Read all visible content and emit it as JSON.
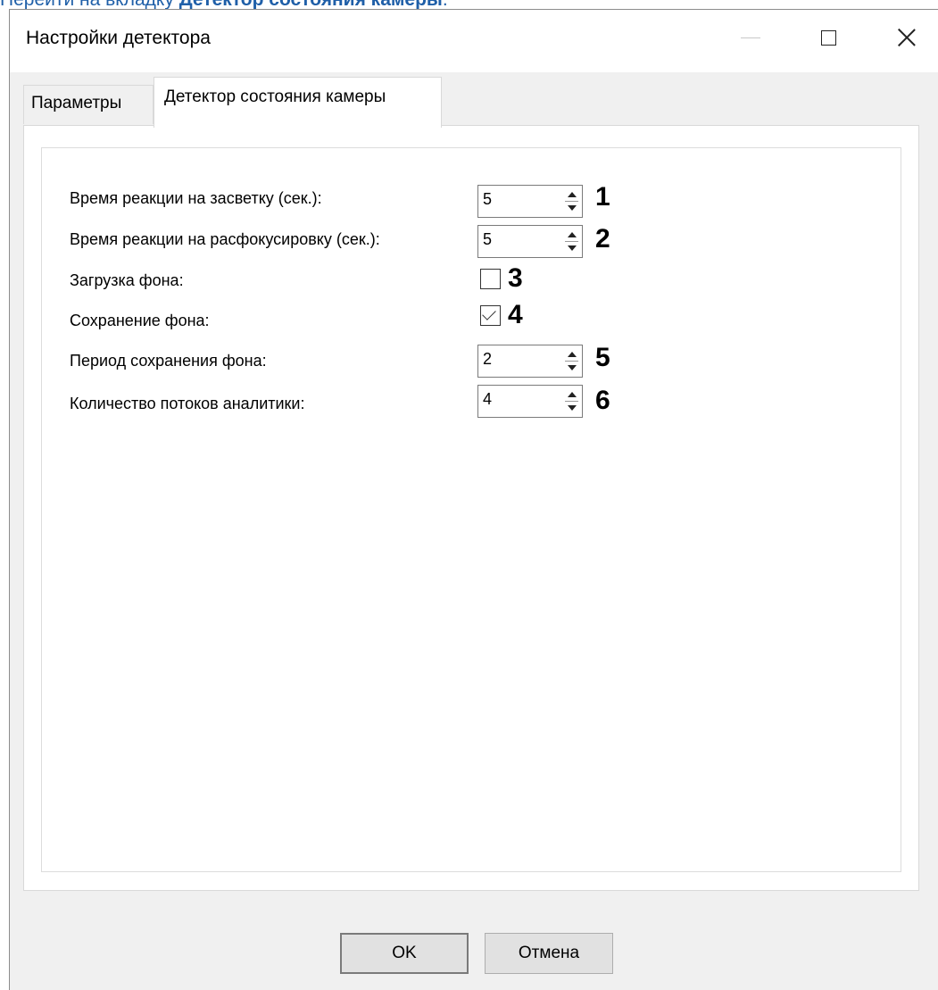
{
  "caption": {
    "prefix": "Перейти на вкладку ",
    "bold": "Детектор состояния камеры",
    "suffix": "."
  },
  "window": {
    "title": "Настройки детектора"
  },
  "tabs": [
    {
      "label": "Параметры",
      "active": false
    },
    {
      "label": "Детектор состояния камеры",
      "active": true
    }
  ],
  "fields": {
    "flare_time": {
      "label": "Время реакции на засветку (сек.):",
      "value": "5",
      "marker": "1"
    },
    "defocus_time": {
      "label": "Время реакции на расфокусировку (сек.):",
      "value": "5",
      "marker": "2"
    },
    "load_background": {
      "label": "Загрузка фона:",
      "checked": false,
      "marker": "3"
    },
    "save_background": {
      "label": "Сохранение фона:",
      "checked": true,
      "marker": "4"
    },
    "save_period": {
      "label": "Период сохранения фона:",
      "value": "2",
      "marker": "5"
    },
    "threads": {
      "label": "Количество потоков аналитики:",
      "value": "4",
      "marker": "6"
    }
  },
  "buttons": {
    "ok": "OK",
    "cancel": "Отмена"
  }
}
